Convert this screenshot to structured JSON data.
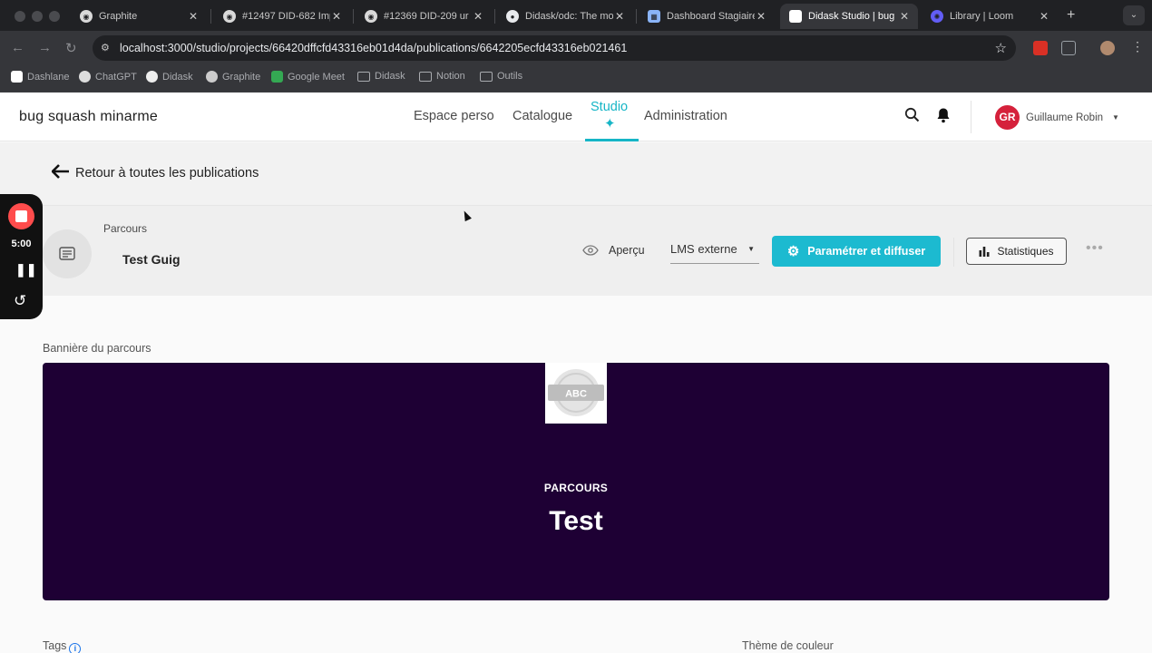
{
  "browser": {
    "tabs": [
      {
        "title": "Graphite",
        "active": false
      },
      {
        "title": "#12497 DID-682 Imp",
        "active": false
      },
      {
        "title": "#12369 DID-209 ur",
        "active": false
      },
      {
        "title": "Didask/odc: The mo",
        "active": false
      },
      {
        "title": "Dashboard Stagiaire",
        "active": false
      },
      {
        "title": "Didask Studio | bug",
        "active": true
      },
      {
        "title": "Library | Loom",
        "active": false
      }
    ],
    "url": "localhost:3000/studio/projects/66420dffcfd43316eb01d4da/publications/6642205ecfd43316eb021461",
    "bookmarks": [
      "Dashlane",
      "ChatGPT",
      "Didask",
      "Graphite",
      "Google Meet",
      "Didask",
      "Notion",
      "Outils"
    ]
  },
  "app": {
    "brand": "bug squash minarme",
    "nav": [
      "Espace perso",
      "Catalogue",
      "Studio",
      "Administration"
    ],
    "active_nav": "Studio",
    "user": {
      "initials": "GR",
      "name": "Guillaume Robin"
    },
    "accent_color": "#16b5c6"
  },
  "back": {
    "label": "Retour à toutes les publications"
  },
  "publication": {
    "type": "Parcours",
    "title": "Test Guig",
    "preview_label": "Aperçu",
    "lms_select": "LMS externe",
    "primary_button": "Paramétrer et diffuser",
    "stats_button": "Statistiques"
  },
  "content": {
    "banner_label": "Bannière du parcours",
    "banner_logo_text": "ABC",
    "banner_kicker": "PARCOURS",
    "banner_title": "Test",
    "banner_color": "#1e0034",
    "tags_label": "Tags",
    "theme_label": "Thème de couleur"
  },
  "loom": {
    "timer": "5:00"
  }
}
